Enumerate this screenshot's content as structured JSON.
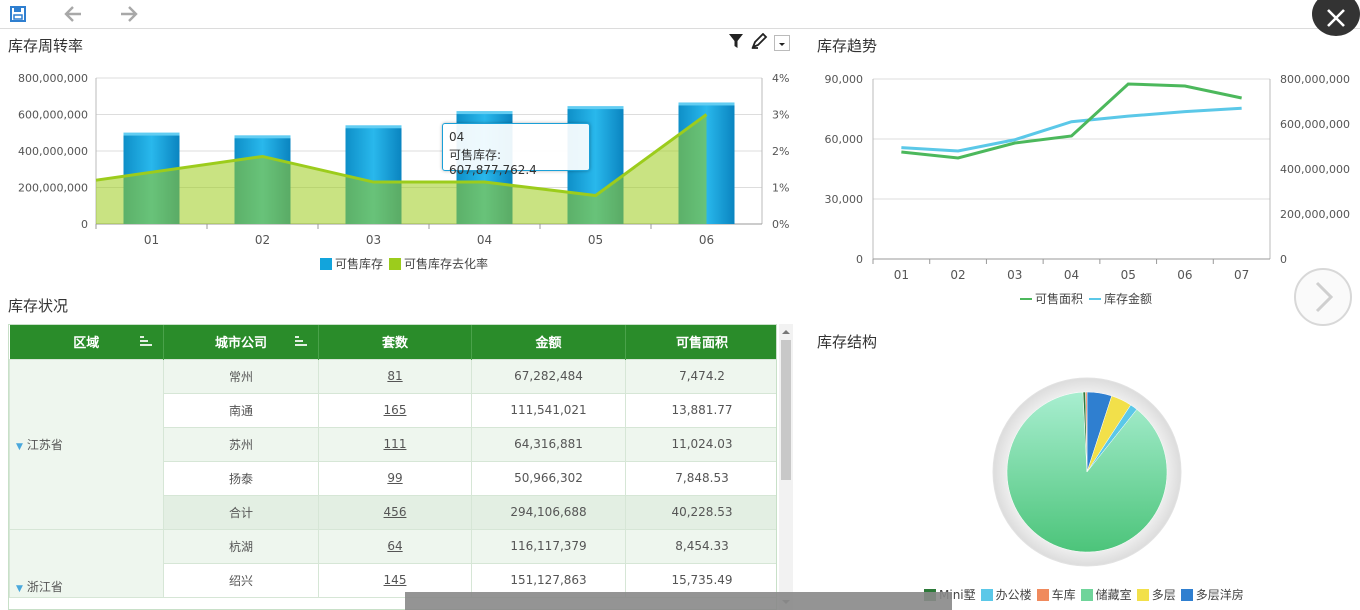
{
  "toolbar": {
    "save_icon": "save-icon",
    "back_icon": "arrow-left-icon",
    "forward_icon": "arrow-right-icon",
    "close_icon": "close-icon"
  },
  "panels": {
    "turnover": {
      "title": "库存周转率"
    },
    "trend": {
      "title": "库存趋势"
    },
    "status": {
      "title": "库存状况"
    },
    "structure": {
      "title": "库存结构"
    }
  },
  "tooltip": {
    "line1": "04",
    "line2": "可售库存: 607,877,762.4"
  },
  "chart_data": [
    {
      "type": "bar",
      "categories": [
        "01",
        "02",
        "03",
        "04",
        "05",
        "06"
      ],
      "series": [
        {
          "name": "可售库存",
          "type": "bar",
          "axis": "left",
          "values": [
            490000000,
            475000000,
            530000000,
            607877762.4,
            635000000,
            655000000
          ],
          "color": "#12a4dc"
        },
        {
          "name": "可售库存去化率",
          "type": "area",
          "axis": "right",
          "values": [
            1.2,
            1.85,
            1.15,
            1.15,
            0.78,
            3.0
          ],
          "color": "#9ccc1c"
        }
      ],
      "left_ticks": [
        "800,000,000",
        "600,000,000",
        "400,000,000",
        "200,000,000",
        "0"
      ],
      "right_ticks": [
        "4%",
        "3%",
        "2%",
        "1%",
        "0%"
      ],
      "ylim": [
        0,
        800000000
      ],
      "y2lim": [
        0,
        4
      ]
    },
    {
      "type": "line",
      "categories": [
        "01",
        "02",
        "03",
        "04",
        "05",
        "06",
        "07"
      ],
      "series": [
        {
          "name": "可售面积",
          "axis": "left",
          "values": [
            53500,
            50500,
            58000,
            61500,
            87500,
            86500,
            80500
          ],
          "color": "#4cb85c"
        },
        {
          "name": "库存金额",
          "axis": "right",
          "values": [
            495000000,
            480000000,
            530000000,
            610000000,
            635000000,
            655000000,
            670000000
          ],
          "color": "#5bc8e8"
        }
      ],
      "left_ticks": [
        "90,000",
        "60,000",
        "30,000",
        "0"
      ],
      "right_ticks": [
        "800,000,000",
        "600,000,000",
        "400,000,000",
        "200,000,000",
        "0"
      ],
      "ylim": [
        0,
        90000
      ],
      "y2lim": [
        0,
        800000000
      ]
    },
    {
      "type": "pie",
      "slices": [
        {
          "name": "Mini墅",
          "value": 0.5,
          "color": "#2d7a3a"
        },
        {
          "name": "办公楼",
          "value": 1.5,
          "color": "#5bc8e8"
        },
        {
          "name": "车库",
          "value": 0.3,
          "color": "#f08a5d"
        },
        {
          "name": "储藏室",
          "value": 88.5,
          "color": "#6fd49a"
        },
        {
          "name": "多层",
          "value": 4.2,
          "color": "#f2e04a"
        },
        {
          "name": "多层洋房",
          "value": 5.0,
          "color": "#2f7fd0"
        }
      ]
    }
  ],
  "table": {
    "headers": [
      "区域",
      "城市公司",
      "套数",
      "金额",
      "可售面积"
    ],
    "regions": [
      {
        "name": "江苏省",
        "rows": [
          {
            "city": "常州",
            "count": "81",
            "amount": "67,282,484",
            "area": "7,474.2"
          },
          {
            "city": "南通",
            "count": "165",
            "amount": "111,541,021",
            "area": "13,881.77"
          },
          {
            "city": "苏州",
            "count": "111",
            "amount": "64,316,881",
            "area": "11,024.03"
          },
          {
            "city": "扬泰",
            "count": "99",
            "amount": "50,966,302",
            "area": "7,848.53"
          },
          {
            "city": "合计",
            "count": "456",
            "amount": "294,106,688",
            "area": "40,228.53"
          }
        ]
      },
      {
        "name": "浙江省",
        "rows": [
          {
            "city": "杭湖",
            "count": "64",
            "amount": "116,117,379",
            "area": "8,454.33"
          },
          {
            "city": "绍兴",
            "count": "145",
            "amount": "151,127,863",
            "area": "15,735.49"
          }
        ]
      }
    ]
  }
}
